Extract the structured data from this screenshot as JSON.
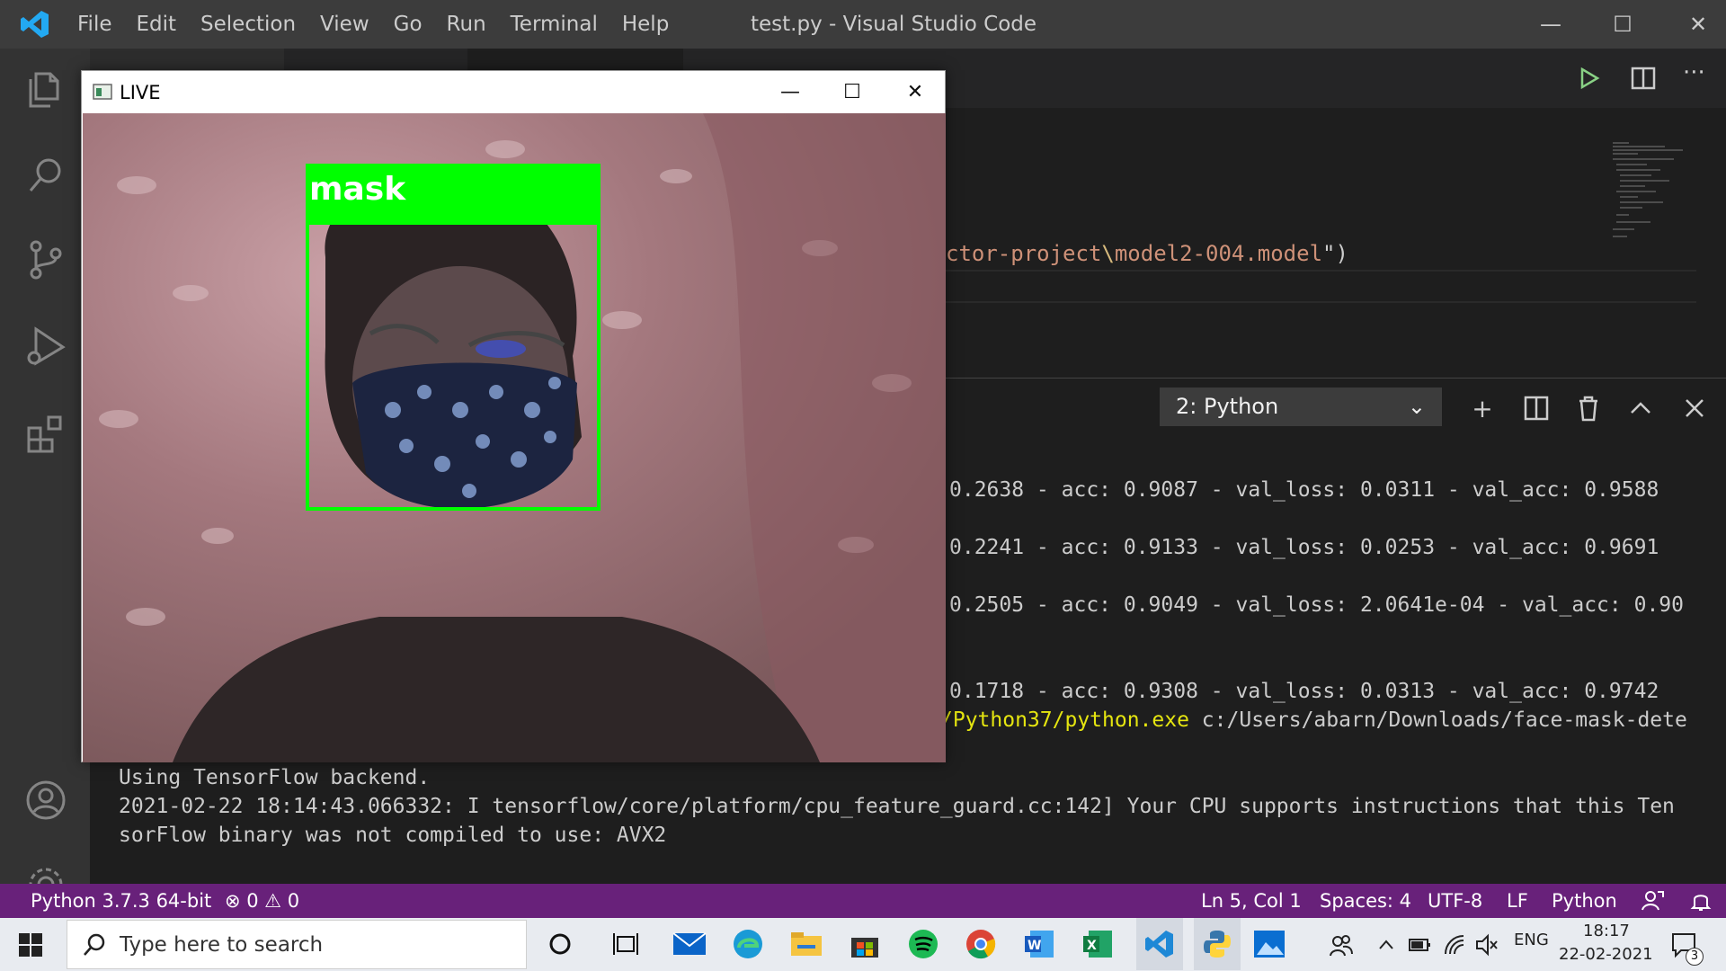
{
  "titlebar": {
    "menu": [
      "File",
      "Edit",
      "Selection",
      "View",
      "Go",
      "Run",
      "Terminal",
      "Help"
    ],
    "title": "test.py - Visual Studio Code",
    "minimize": "—",
    "maximize": "☐",
    "close": "✕"
  },
  "editor": {
    "code_line_prefix": "ctor-project",
    "code_line_sep": "\\",
    "code_line_file": "model2-004.model",
    "code_line_suffix": "\")"
  },
  "terminal": {
    "selected": "2: Python",
    "lines": [
      "0.2638 - acc: 0.9087 - val_loss: 0.0311 - val_acc: 0.9588",
      "0.2241 - acc: 0.9133 - val_loss: 0.0253 - val_acc: 0.9691",
      "0.2505 - acc: 0.9049 - val_loss: 2.0641e-04 - val_acc: 0.90",
      "0.1718 - acc: 0.9308 - val_loss: 0.0313 - val_acc: 0.9742"
    ],
    "exe_yellow": "/Python37/python.exe",
    "exe_white": " c:/Users/abarn/Downloads/face-mask-dete",
    "backend": "Using TensorFlow backend.",
    "cpu_line1": "2021-02-22 18:14:43.066332: I tensorflow/core/platform/cpu_feature_guard.cc:142] Your CPU supports instructions that this Ten",
    "cpu_line2": "sorFlow binary was not compiled to use: AVX2"
  },
  "statusbar": {
    "interpreter": "Python 3.7.3 64-bit",
    "problems": "⊗ 0 ⚠ 0",
    "position": "Ln 5, Col 1",
    "spaces": "Spaces: 4",
    "encoding": "UTF-8",
    "eol": "LF",
    "language": "Python"
  },
  "live_window": {
    "title": "LIVE",
    "detection_label": "mask",
    "box_color": "#00ff00"
  },
  "taskbar": {
    "search_placeholder": "Type here to search",
    "lang": "ENG",
    "time": "18:17",
    "date": "22-02-2021",
    "notifications": "3"
  },
  "colors": {
    "statusbar": "#68217a",
    "titlebar": "#3c3c3c",
    "activitybar": "#333333"
  }
}
